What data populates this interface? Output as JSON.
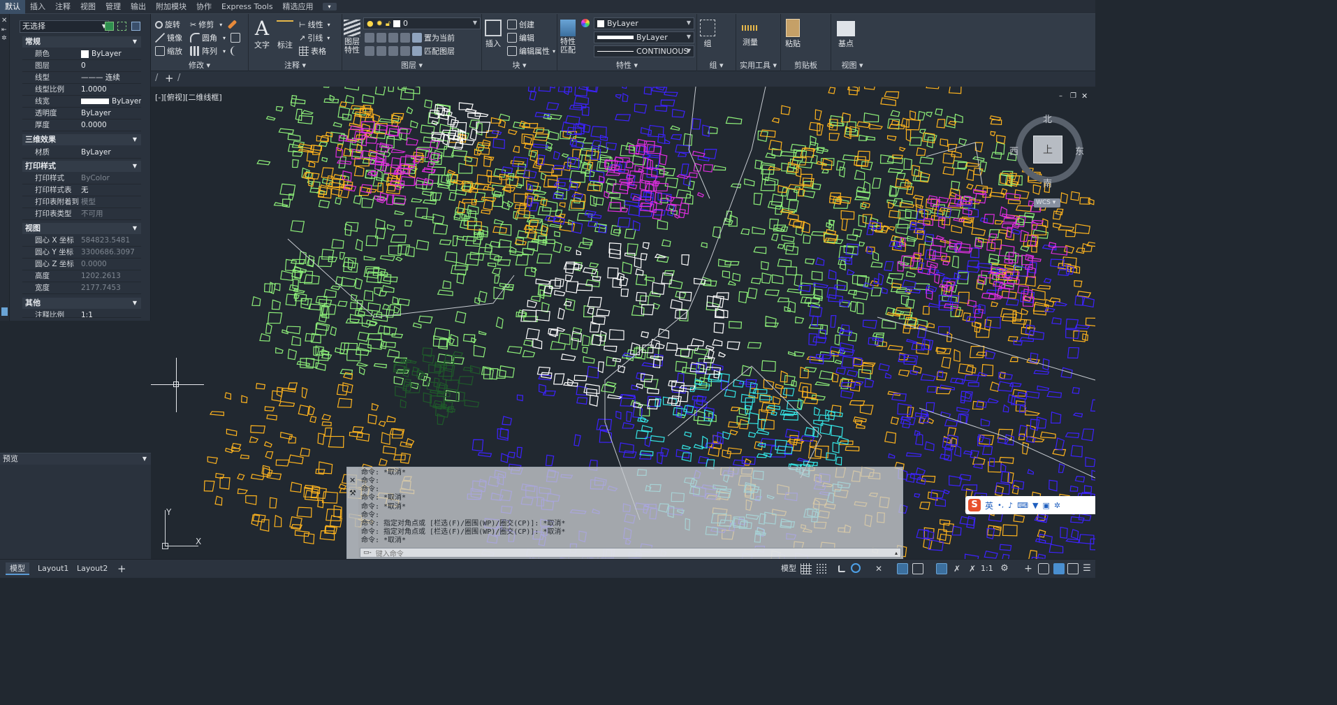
{
  "app_tabs": [
    "默认",
    "插入",
    "注释",
    "视图",
    "管理",
    "输出",
    "附加模块",
    "协作",
    "Express Tools",
    "精选应用"
  ],
  "ribbon": {
    "modify": {
      "label": "修改",
      "move": "旋转",
      "mirror": "镜像",
      "scale": "缩放",
      "trim": "修剪",
      "fillet": "圆角",
      "array": "阵列"
    },
    "annotation": {
      "label": "注释",
      "text": "文字",
      "dimension": "标注",
      "linetype": "线性",
      "leader": "引线",
      "table": "表格"
    },
    "layers": {
      "label": "图层",
      "layer_props": "图层\n特性",
      "layer_value": "0",
      "set_current": "置为当前",
      "match_layer": "匹配图层"
    },
    "block": {
      "label": "块",
      "insert": "插入",
      "create": "创建",
      "edit": "编辑",
      "edit_attr": "编辑属性"
    },
    "properties": {
      "label": "特性",
      "match": "特性\n匹配",
      "color": "ByLayer",
      "lineweight": "ByLayer",
      "linetype": "CONTINUOUS"
    },
    "groups": {
      "label": "组",
      "group": "组"
    },
    "utilities": {
      "label": "实用工具",
      "measure": "测量"
    },
    "clipboard": {
      "label": "剪贴板",
      "paste": "粘贴"
    },
    "view": {
      "label": "视图",
      "base": "基点"
    }
  },
  "properties_panel": {
    "selection": "无选择",
    "sections": {
      "general": "常规",
      "three_d": "三维效果",
      "plot": "打印样式",
      "view": "视图",
      "misc": "其他"
    },
    "general": [
      {
        "k": "颜色",
        "v": "ByLayer"
      },
      {
        "k": "图层",
        "v": "0"
      },
      {
        "k": "线型",
        "v": "——— 连续"
      },
      {
        "k": "线型比例",
        "v": "1.0000"
      },
      {
        "k": "线宽",
        "v": "ByLayer"
      },
      {
        "k": "透明度",
        "v": "ByLayer"
      },
      {
        "k": "厚度",
        "v": "0.0000"
      }
    ],
    "three_d": [
      {
        "k": "材质",
        "v": "ByLayer"
      }
    ],
    "plot": [
      {
        "k": "打印样式",
        "v": "ByColor"
      },
      {
        "k": "打印样式表",
        "v": "无"
      },
      {
        "k": "打印表附着到",
        "v": "模型"
      },
      {
        "k": "打印表类型",
        "v": "不可用"
      }
    ],
    "view": [
      {
        "k": "圆心 X 坐标",
        "v": "584823.5481"
      },
      {
        "k": "圆心 Y 坐标",
        "v": "3300686.3097"
      },
      {
        "k": "圆心 Z 坐标",
        "v": "0.0000"
      },
      {
        "k": "高度",
        "v": "1202.2613"
      },
      {
        "k": "宽度",
        "v": "2177.7453"
      }
    ],
    "misc": [
      {
        "k": "注释比例",
        "v": "1:1"
      }
    ]
  },
  "preview_label": "预览",
  "viewport_label": "[-][俯视][二维线框]",
  "viewcube": {
    "north": "北",
    "south": "南",
    "east": "东",
    "west": "西",
    "top": "上",
    "wcs": "WCS"
  },
  "ucs": {
    "x": "X",
    "y": "Y"
  },
  "command_history": [
    "命令: *取消*",
    "命令:",
    "命令:",
    "命令: *取消*",
    "命令: *取消*",
    "命令:",
    "命令: 指定对角点或 [栏选(F)/圈围(WP)/圈交(CP)]: *取消*",
    "命令: 指定对角点或 [栏选(F)/圈围(WP)/圈交(CP)]: *取消*",
    "命令: *取消*"
  ],
  "command_input_placeholder": "键入命令",
  "status": {
    "tabs": [
      "模型",
      "Layout1",
      "Layout2"
    ],
    "model_label": "模型",
    "scale": "1:1"
  },
  "ime": {
    "label": "英"
  }
}
